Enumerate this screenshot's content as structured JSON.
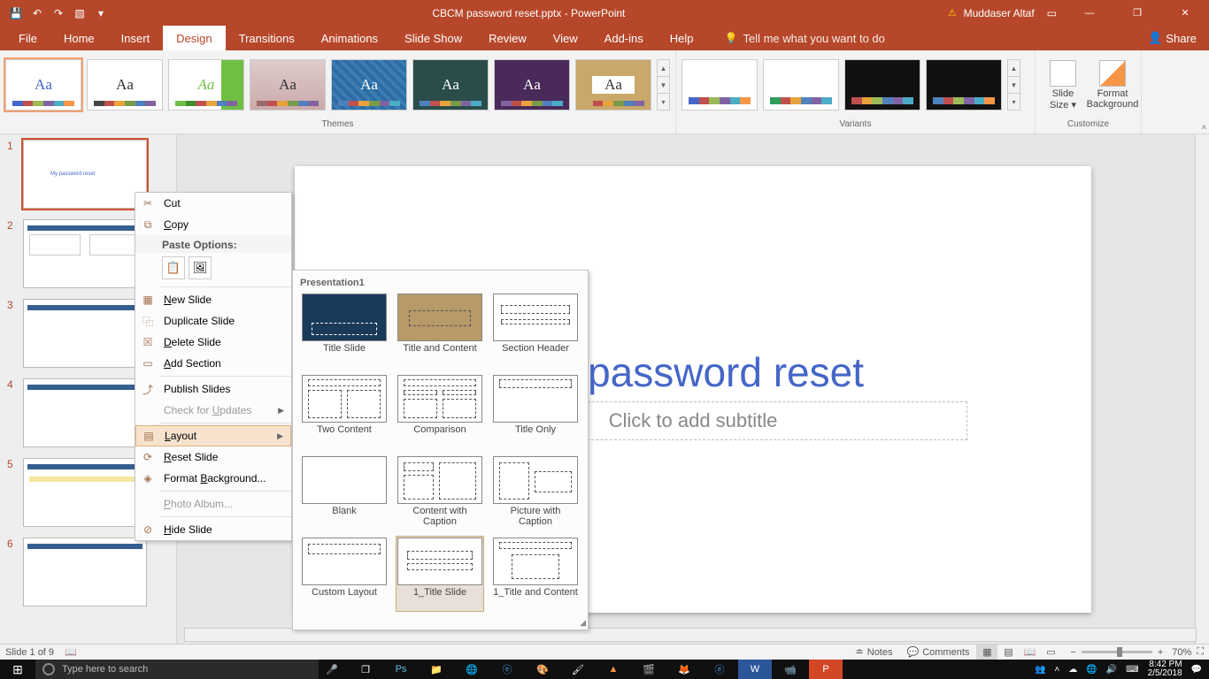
{
  "titlebar": {
    "filename": "CBCM password reset.pptx - PowerPoint",
    "user": "Muddaser Altaf"
  },
  "tabs": {
    "file": "File",
    "home": "Home",
    "insert": "Insert",
    "design": "Design",
    "transitions": "Transitions",
    "animations": "Animations",
    "slideshow": "Slide Show",
    "review": "Review",
    "view": "View",
    "addins": "Add-ins",
    "help": "Help",
    "tellme": "Tell me what you want to do",
    "share": "Share"
  },
  "ribbon": {
    "themes_label": "Themes",
    "variants_label": "Variants",
    "customize_label": "Customize",
    "slide_size": "Slide\nSize ▾",
    "format_bg": "Format\nBackground"
  },
  "thumbs": {
    "s1_title": "My password reset"
  },
  "slide": {
    "title": "My password reset",
    "subtitle": "Click to add subtitle"
  },
  "ctx": {
    "cut": "Cut",
    "copy": "Copy",
    "paste_hdr": "Paste Options:",
    "new_slide": "New Slide",
    "dup": "Duplicate Slide",
    "del": "Delete Slide",
    "add_section": "Add Section",
    "publish": "Publish Slides",
    "check": "Check for Updates",
    "layout": "Layout",
    "reset": "Reset Slide",
    "format_bg": "Format Background...",
    "photo": "Photo Album...",
    "hide": "Hide Slide"
  },
  "layout": {
    "hdr": "Presentation1",
    "names": [
      "Title Slide",
      "Title and Content",
      "Section Header",
      "Two Content",
      "Comparison",
      "Title Only",
      "Blank",
      "Content with Caption",
      "Picture with Caption",
      "Custom Layout",
      "1_Title Slide",
      "1_Title and Content"
    ]
  },
  "status": {
    "slide": "Slide 1 of 9",
    "notes": "Notes",
    "comments": "Comments",
    "zoom": "70%"
  },
  "taskbar": {
    "search": "Type here to search",
    "time": "8:42 PM",
    "date": "2/5/2018"
  }
}
